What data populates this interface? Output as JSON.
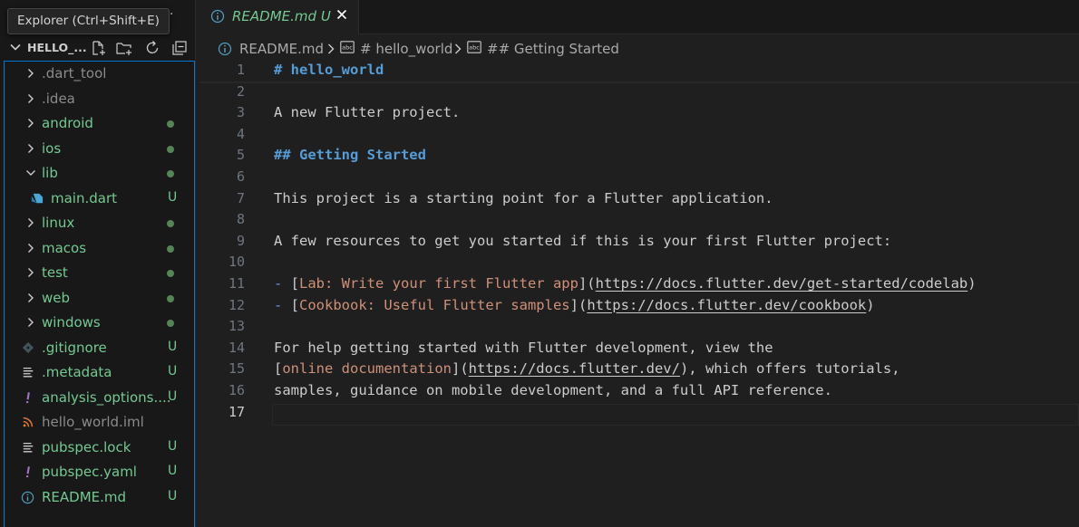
{
  "explorer": {
    "tooltip": "Explorer (Ctrl+Shift+E)",
    "more_label": "···",
    "project_name": "HELLO_...",
    "actions": [
      "new-file-icon",
      "new-folder-icon",
      "refresh-icon",
      "collapse-all-icon"
    ]
  },
  "tree": [
    {
      "label": ".dart_tool",
      "type": "folder",
      "expanded": false,
      "color": "#8b8b8b",
      "status": ""
    },
    {
      "label": ".idea",
      "type": "folder",
      "expanded": false,
      "color": "#8b8b8b",
      "status": ""
    },
    {
      "label": "android",
      "type": "folder",
      "expanded": false,
      "color": "#73c991",
      "status": "dot"
    },
    {
      "label": "ios",
      "type": "folder",
      "expanded": false,
      "color": "#73c991",
      "status": "dot"
    },
    {
      "label": "lib",
      "type": "folder",
      "expanded": true,
      "color": "#73c991",
      "status": "dot"
    },
    {
      "label": "main.dart",
      "type": "file",
      "icon": "dart-icon",
      "color": "#73c991",
      "status": "U",
      "indent": 1
    },
    {
      "label": "linux",
      "type": "folder",
      "expanded": false,
      "color": "#73c991",
      "status": "dot"
    },
    {
      "label": "macos",
      "type": "folder",
      "expanded": false,
      "color": "#73c991",
      "status": "dot"
    },
    {
      "label": "test",
      "type": "folder",
      "expanded": false,
      "color": "#73c991",
      "status": "dot"
    },
    {
      "label": "web",
      "type": "folder",
      "expanded": false,
      "color": "#73c991",
      "status": "dot"
    },
    {
      "label": "windows",
      "type": "folder",
      "expanded": false,
      "color": "#73c991",
      "status": "dot"
    },
    {
      "label": ".gitignore",
      "type": "file",
      "icon": "git-icon",
      "color": "#73c991",
      "status": "U"
    },
    {
      "label": ".metadata",
      "type": "file",
      "icon": "lines-icon",
      "color": "#73c991",
      "status": "U"
    },
    {
      "label": "analysis_options....",
      "type": "file",
      "icon": "yaml-icon",
      "color": "#73c991",
      "status": "U"
    },
    {
      "label": "hello_world.iml",
      "type": "file",
      "icon": "rss-icon",
      "color": "#8b8b8b",
      "status": ""
    },
    {
      "label": "pubspec.lock",
      "type": "file",
      "icon": "lines-icon",
      "color": "#73c991",
      "status": "U"
    },
    {
      "label": "pubspec.yaml",
      "type": "file",
      "icon": "yaml-icon",
      "color": "#73c991",
      "status": "U"
    },
    {
      "label": "README.md",
      "type": "file",
      "icon": "info-icon",
      "color": "#73c991",
      "status": "U"
    }
  ],
  "tab": {
    "label": "README.md",
    "status": "U"
  },
  "breadcrumb": {
    "file": "README.md",
    "items": [
      "# hello_world",
      "## Getting Started"
    ]
  },
  "editor": {
    "active_line": 17,
    "lines": [
      [
        {
          "t": "# hello_world",
          "c": "md-head"
        }
      ],
      [],
      [
        {
          "t": "A new Flutter project."
        }
      ],
      [],
      [
        {
          "t": "## Getting Started",
          "c": "md-head"
        }
      ],
      [],
      [
        {
          "t": "This project is a starting point for a Flutter application."
        }
      ],
      [],
      [
        {
          "t": "A few resources to get you started if this is your first Flutter project:"
        }
      ],
      [],
      [
        {
          "t": "- ",
          "c": "md-bullet"
        },
        {
          "t": "[",
          "c": "md-punct"
        },
        {
          "t": "Lab: Write your first Flutter app",
          "c": "md-link-text"
        },
        {
          "t": "](",
          "c": "md-punct"
        },
        {
          "t": "https://docs.flutter.dev/get-started/codelab",
          "c": "md-url"
        },
        {
          "t": ")",
          "c": "md-punct"
        }
      ],
      [
        {
          "t": "- ",
          "c": "md-bullet"
        },
        {
          "t": "[",
          "c": "md-punct"
        },
        {
          "t": "Cookbook: Useful Flutter samples",
          "c": "md-link-text"
        },
        {
          "t": "](",
          "c": "md-punct"
        },
        {
          "t": "https://docs.flutter.dev/cookbook",
          "c": "md-url"
        },
        {
          "t": ")",
          "c": "md-punct"
        }
      ],
      [],
      [
        {
          "t": "For help getting started with Flutter development, view the"
        }
      ],
      [
        {
          "t": "[",
          "c": "md-punct"
        },
        {
          "t": "online documentation",
          "c": "md-link-text"
        },
        {
          "t": "](",
          "c": "md-punct"
        },
        {
          "t": "https://docs.flutter.dev/",
          "c": "md-url"
        },
        {
          "t": "), which offers tutorials,",
          "c": "md-punct"
        }
      ],
      [
        {
          "t": "samples, guidance on mobile development, and a full API reference."
        }
      ],
      []
    ]
  }
}
